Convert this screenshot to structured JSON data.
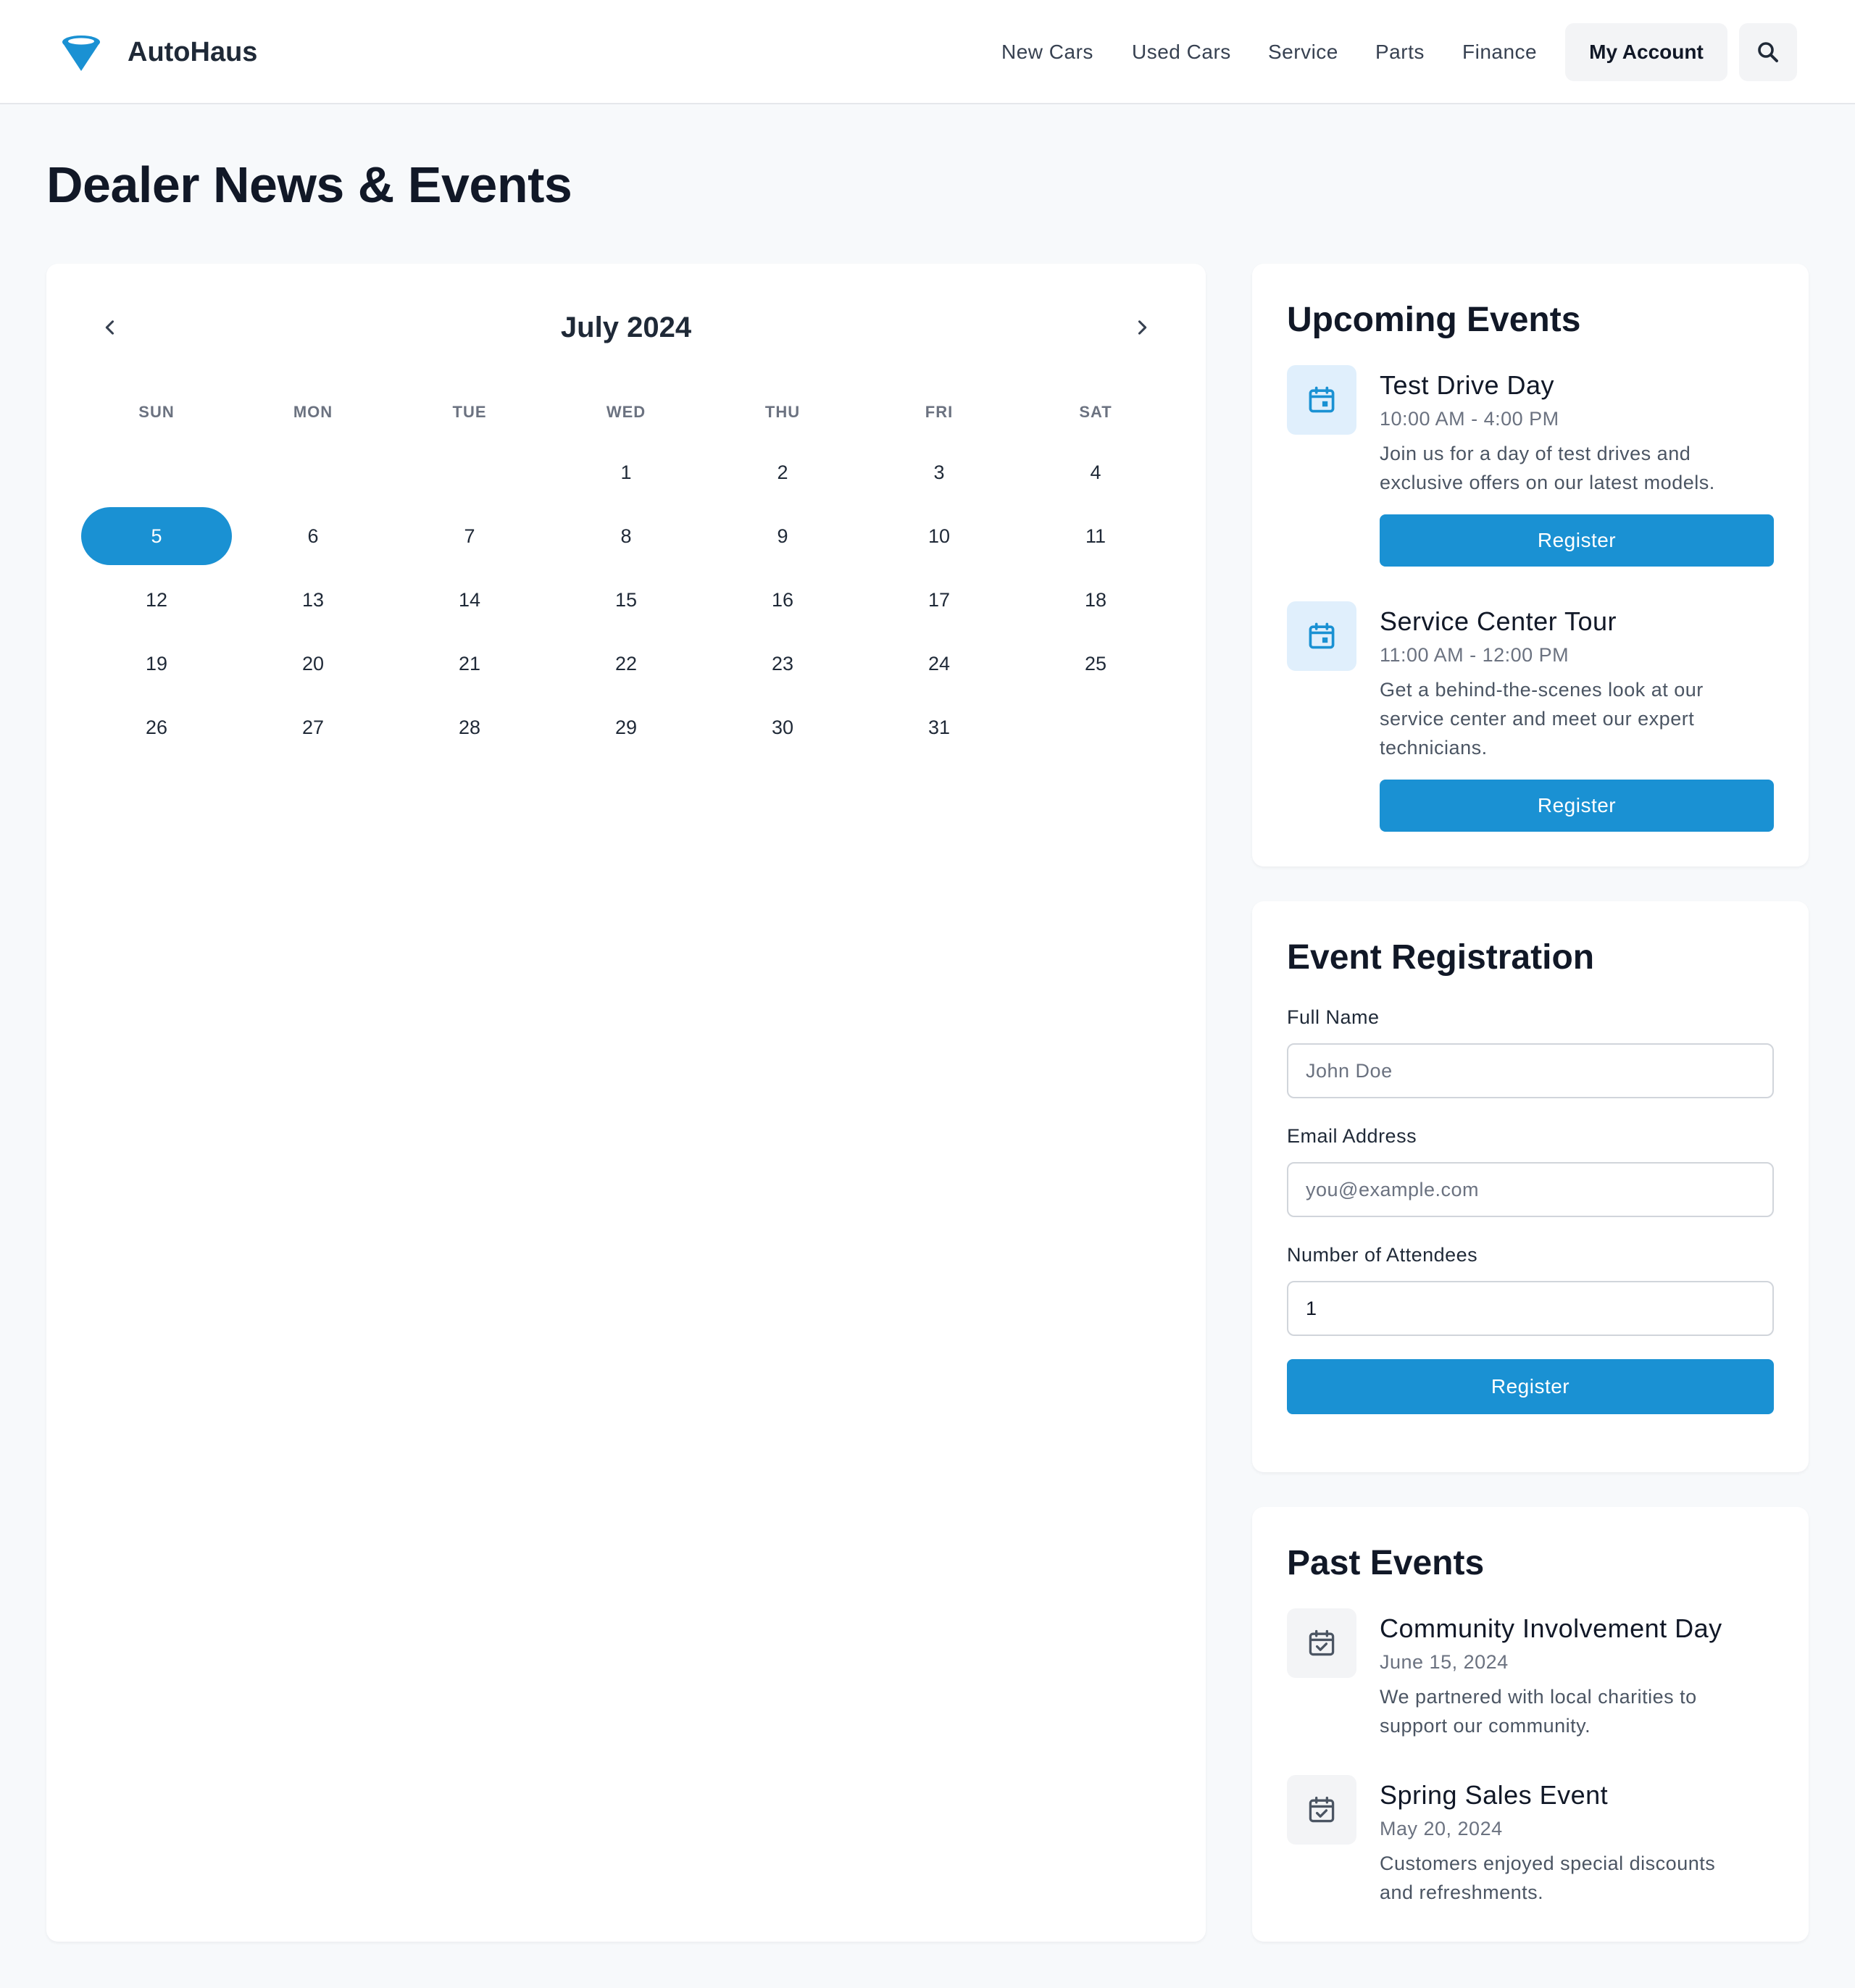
{
  "brand": {
    "name": "AutoHaus",
    "color": "#1a91d3",
    "icon": "funnel-logo-icon"
  },
  "nav": {
    "links": [
      "New Cars",
      "Used Cars",
      "Service",
      "Parts",
      "Finance"
    ],
    "account_label": "My Account",
    "search_icon": "search-icon"
  },
  "page": {
    "title": "Dealer News & Events"
  },
  "calendar": {
    "month_label": "July 2024",
    "prev_icon": "chevron-left-icon",
    "next_icon": "chevron-right-icon",
    "weekdays": [
      "SUN",
      "MON",
      "TUE",
      "WED",
      "THU",
      "FRI",
      "SAT"
    ],
    "first_weekday_index": 3,
    "days_in_month": 31,
    "selected_day": 5,
    "days": [
      "1",
      "2",
      "3",
      "4",
      "5",
      "6",
      "7",
      "8",
      "9",
      "10",
      "11",
      "12",
      "13",
      "14",
      "15",
      "16",
      "17",
      "18",
      "19",
      "20",
      "21",
      "22",
      "23",
      "24",
      "25",
      "26",
      "27",
      "28",
      "29",
      "30",
      "31"
    ]
  },
  "upcoming": {
    "title": "Upcoming Events",
    "events": [
      {
        "title": "Test Drive Day",
        "time": "10:00 AM - 4:00 PM",
        "desc_lines": [
          "Join us for a day of test drives and",
          "exclusive offers on our latest models."
        ],
        "button": "Register",
        "icon": "calendar-icon"
      },
      {
        "title": "Service Center Tour",
        "time": "11:00 AM - 12:00 PM",
        "desc_lines": [
          "Get a behind-the-scenes look at our",
          "service center and meet our expert",
          "technicians."
        ],
        "button": "Register",
        "icon": "calendar-icon"
      }
    ]
  },
  "registration": {
    "title": "Event Registration",
    "name_label": "Full Name",
    "name_placeholder": "John Doe",
    "email_label": "Email Address",
    "email_placeholder": "you@example.com",
    "attendees_label": "Number of Attendees",
    "attendees_value": "1",
    "submit": "Register"
  },
  "past": {
    "title": "Past Events",
    "events": [
      {
        "title": "Community Involvement Day",
        "date": "June 15, 2024",
        "desc_lines": [
          "We partnered with local charities to",
          "support our community."
        ],
        "icon": "calendar-check-icon"
      },
      {
        "title": "Spring Sales Event",
        "date": "May 20, 2024",
        "desc_lines": [
          "Customers enjoyed special discounts",
          "and refreshments."
        ],
        "icon": "calendar-check-icon"
      }
    ]
  },
  "colors": {
    "accent": "#1a91d3",
    "icon_bg_blue": "#e0effc",
    "icon_bg_gray": "#f3f4f6",
    "page_bg": "#f7f9fb"
  }
}
